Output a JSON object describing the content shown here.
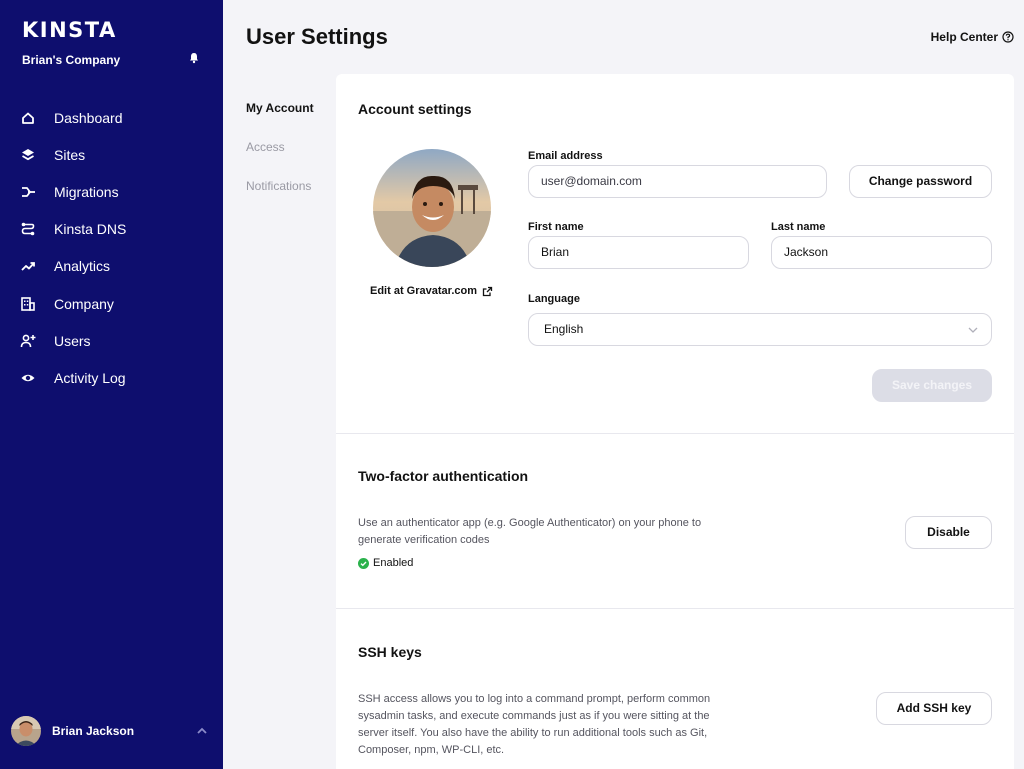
{
  "sidebar": {
    "logo": "KINSTA",
    "company": "Brian's Company",
    "nav": [
      {
        "label": "Dashboard",
        "icon": "home-icon"
      },
      {
        "label": "Sites",
        "icon": "layers-icon"
      },
      {
        "label": "Migrations",
        "icon": "migrations-icon"
      },
      {
        "label": "Kinsta DNS",
        "icon": "dns-icon"
      },
      {
        "label": "Analytics",
        "icon": "trending-up-icon"
      },
      {
        "label": "Company",
        "icon": "building-icon"
      },
      {
        "label": "Users",
        "icon": "add-user-icon"
      },
      {
        "label": "Activity Log",
        "icon": "eye-icon"
      }
    ],
    "user_name": "Brian Jackson"
  },
  "header": {
    "title": "User Settings",
    "help_label": "Help Center"
  },
  "subnav": {
    "items": [
      "My Account",
      "Access",
      "Notifications"
    ],
    "active": "My Account"
  },
  "account": {
    "title": "Account settings",
    "gravatar_label": "Edit at Gravatar.com",
    "email_label": "Email address",
    "email_value": "user@domain.com",
    "change_password_label": "Change password",
    "first_name_label": "First name",
    "first_name_value": "Brian",
    "last_name_label": "Last name",
    "last_name_value": "Jackson",
    "language_label": "Language",
    "language_value": "English",
    "save_label": "Save changes"
  },
  "two_factor": {
    "title": "Two-factor authentication",
    "description_line1": "Use an authenticator app (e.g. Google Authenticator) on your phone to",
    "description_line2": "generate verification codes",
    "status": "Enabled",
    "disable_label": "Disable"
  },
  "ssh": {
    "title": "SSH keys",
    "description_line1": "SSH access allows you to log into a command prompt, perform common",
    "description_line2": "sysadmin tasks, and execute commands just as if you were sitting at the",
    "description_line3": "server itself. You also have the ability to run additional tools such as Git,",
    "description_line4": "Composer, npm, WP-CLI, etc.",
    "add_label": "Add SSH key"
  },
  "colors": {
    "sidebar_bg": "#0e0e6e",
    "success": "#2bb24c",
    "page_bg": "#f4f4f8"
  }
}
